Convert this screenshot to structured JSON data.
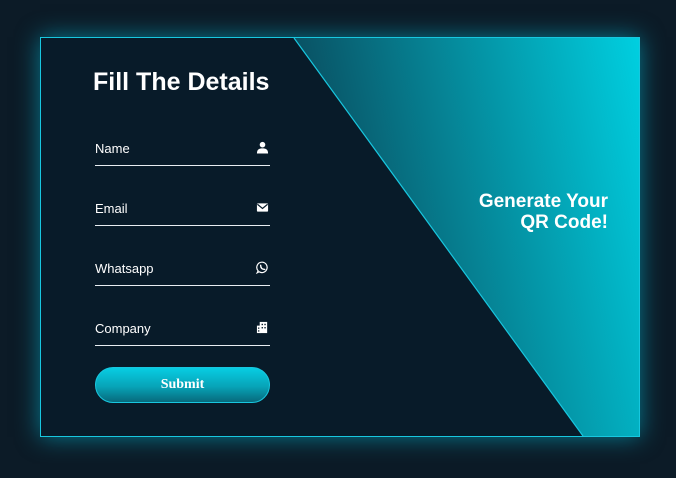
{
  "form": {
    "title": "Fill The Details",
    "fields": [
      {
        "placeholder": "Name",
        "icon": "user-icon"
      },
      {
        "placeholder": "Email",
        "icon": "envelope-icon"
      },
      {
        "placeholder": "Whatsapp",
        "icon": "whatsapp-icon"
      },
      {
        "placeholder": "Company",
        "icon": "building-icon"
      }
    ],
    "submit_label": "Submit"
  },
  "promo": {
    "line1": "Generate Your",
    "line2": "QR Code!"
  },
  "colors": {
    "background": "#0c1b27",
    "card": "#081b29",
    "accent": "#18c7df",
    "gradient_light": "#00cfe0",
    "gradient_dark": "#0a4a5c"
  }
}
